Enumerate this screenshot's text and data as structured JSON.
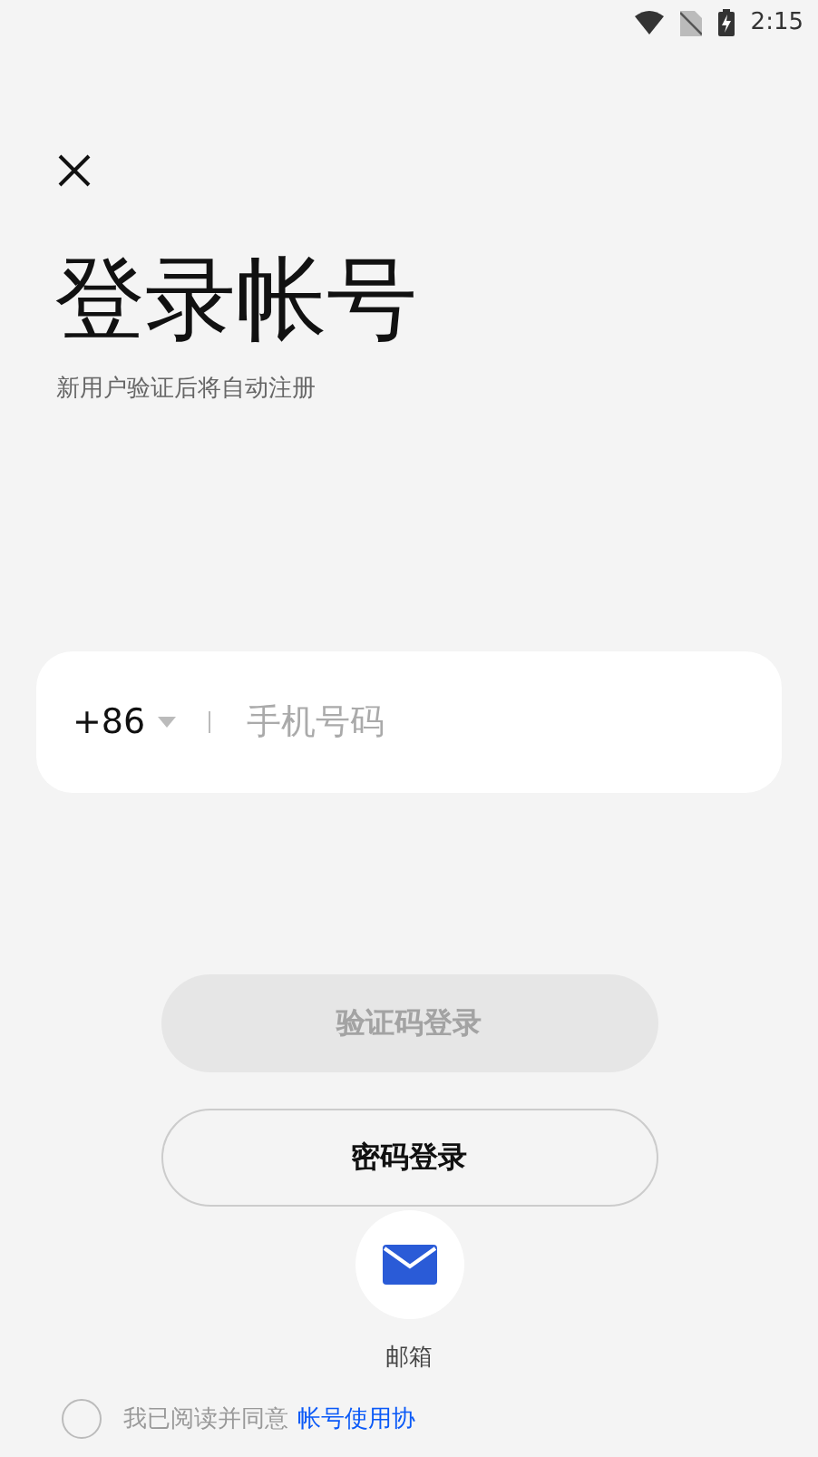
{
  "status_bar": {
    "time": "2:15"
  },
  "header": {
    "title": "登录帐号",
    "subtitle": "新用户验证后将自动注册"
  },
  "phone_field": {
    "country_code": "+86",
    "placeholder": "手机号码"
  },
  "buttons": [
    {
      "label": "验证码登录",
      "kind": "filled",
      "disabled": true
    },
    {
      "label": "密码登录",
      "kind": "outline",
      "disabled": false
    }
  ],
  "alt_login": [
    {
      "label": "邮箱"
    }
  ],
  "agreement": {
    "checked": false,
    "text": "我已阅读并同意",
    "link": "帐号使用协"
  }
}
